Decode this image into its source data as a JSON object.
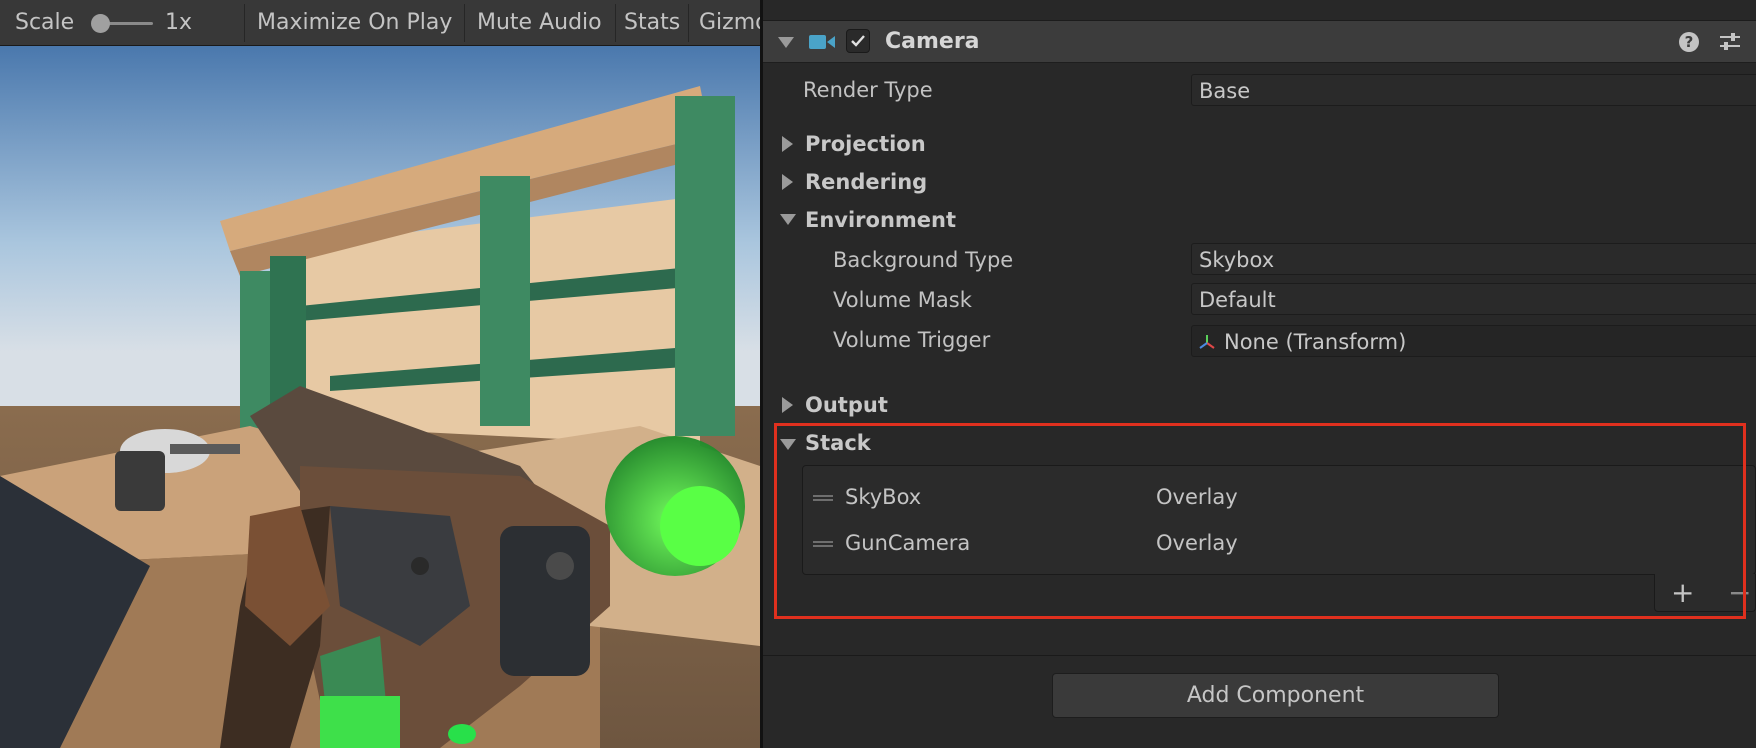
{
  "game_view": {
    "toolbar": {
      "scale_label": "Scale",
      "scale_value": "1x",
      "maximize_on_play": "Maximize On Play",
      "mute_audio": "Mute Audio",
      "stats": "Stats",
      "gizmos": "Gizmo"
    }
  },
  "inspector": {
    "component": {
      "title": "Camera",
      "enabled": true,
      "help_icon": "?"
    },
    "render_type": {
      "label": "Render Type",
      "value": "Base"
    },
    "foldouts": {
      "projection": "Projection",
      "rendering": "Rendering",
      "environment": "Environment",
      "output": "Output",
      "stack": "Stack"
    },
    "environment": {
      "background_type": {
        "label": "Background Type",
        "value": "Skybox"
      },
      "volume_mask": {
        "label": "Volume Mask",
        "value": "Default"
      },
      "volume_trigger": {
        "label": "Volume Trigger",
        "value": "None (Transform)"
      }
    },
    "stack": {
      "items": [
        {
          "name": "SkyBox",
          "type": "Overlay"
        },
        {
          "name": "GunCamera",
          "type": "Overlay"
        }
      ],
      "add_glyph": "+",
      "remove_glyph": "−",
      "highlight_color": "#e0301e"
    },
    "add_component_label": "Add Component"
  },
  "colors": {
    "panel_bg": "#282828",
    "header_bg": "#3c3c3c",
    "field_bg": "#2a2a2a",
    "camera_icon": "#4aa3c8"
  }
}
